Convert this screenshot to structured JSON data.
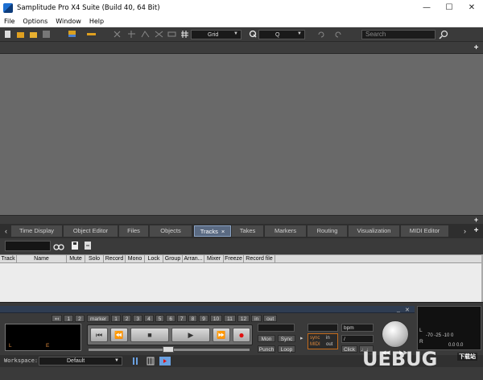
{
  "window": {
    "title": "Samplitude Pro X4 Suite (Build 40, 64 Bit)"
  },
  "menu": [
    "File",
    "Options",
    "Window",
    "Help"
  ],
  "toolbar": {
    "grid_value": "Grid",
    "quantize_value": "Q",
    "search_placeholder": "Search"
  },
  "tabs": [
    {
      "label": "Time Display",
      "active": false
    },
    {
      "label": "Object Editor",
      "active": false
    },
    {
      "label": "Files",
      "active": false
    },
    {
      "label": "Objects",
      "active": false
    },
    {
      "label": "Tracks",
      "active": true,
      "close": "×"
    },
    {
      "label": "Takes",
      "active": false
    },
    {
      "label": "Markers",
      "active": false
    },
    {
      "label": "Routing",
      "active": false
    },
    {
      "label": "Visualization",
      "active": false
    },
    {
      "label": "MIDI Editor",
      "active": false
    }
  ],
  "track_columns": [
    "Track",
    "Name",
    "Mute",
    "Solo",
    "Record",
    "Mono",
    "Lock",
    "Group",
    "Arran...",
    "Mixer",
    "Freeze",
    "Record file"
  ],
  "transport": {
    "marker_label": "marker",
    "markers": [
      "1",
      "2",
      "3",
      "4",
      "5",
      "6",
      "7",
      "8",
      "9",
      "10",
      "11",
      "12"
    ],
    "in_label": "in",
    "out_label": "out",
    "left_pre": [
      "1",
      "2"
    ],
    "display_left": "L",
    "display_e": "E",
    "buttons": {
      "mon": "Mon",
      "sync": "Sync",
      "punch": "Punch",
      "loop": "Loop",
      "bpm": "bpm",
      "slash": "/",
      "click": "Click"
    },
    "sync_box": {
      "sync": "sync",
      "midi": "MIDI",
      "in": "in",
      "out": "out"
    },
    "meter": {
      "l": "L",
      "r": "R",
      "scale": "-70 -25 -10 0",
      "values": "0.0   0.0"
    }
  },
  "workspace": {
    "label": "Workspace:",
    "value": "Default"
  },
  "watermark": {
    "text": "UEBUG",
    "sub": "下载站"
  },
  "colors": {
    "accent_tab": "#5a6a82",
    "record": "#e01010",
    "display_text": "#e08a3c"
  }
}
